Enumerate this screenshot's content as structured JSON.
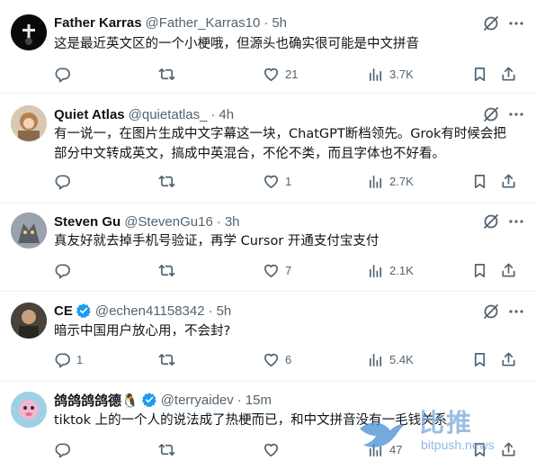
{
  "tweets": [
    {
      "name": "Father Karras",
      "handle": "@Father_Karras10",
      "dot": "·",
      "time": "5h",
      "verified": false,
      "lines": [
        "这是最近英文区的一个小梗哦，但源头也确实很可能是中文拼音"
      ],
      "replies": "",
      "retweets": "",
      "likes": "21",
      "views": "3.7K"
    },
    {
      "name": "Quiet Atlas",
      "handle": "@quietatlas_",
      "dot": "·",
      "time": "4h",
      "verified": false,
      "lines": [
        "有一说一，在图片生成中文字幕这一块，ChatGPT断档领先。Grok有时候会把",
        "部分中文转成英文，搞成中英混合，不伦不类，而且字体也不好看。"
      ],
      "replies": "",
      "retweets": "",
      "likes": "1",
      "views": "2.7K"
    },
    {
      "name": "Steven Gu",
      "handle": "@StevenGu16",
      "dot": "·",
      "time": "3h",
      "verified": false,
      "lines": [
        "真友好就去掉手机号验证，再学 Cursor 开通支付宝支付"
      ],
      "replies": "",
      "retweets": "",
      "likes": "7",
      "views": "2.1K"
    },
    {
      "name": "CE",
      "handle": "@echen41158342",
      "dot": "·",
      "time": "5h",
      "verified": true,
      "lines": [
        "暗示中国用户放心用，不会封?"
      ],
      "replies": "1",
      "retweets": "",
      "likes": "6",
      "views": "5.4K"
    },
    {
      "name": "鸽鸽鸽鸽德🐧",
      "handle": "@terryaidev",
      "dot": "·",
      "time": "15m",
      "verified": true,
      "lines": [
        "tiktok 上的一个人的说法成了热梗而已，和中文拼音没有一毛钱关系"
      ],
      "replies": "",
      "retweets": "",
      "likes": "",
      "views": "47"
    }
  ],
  "watermark": {
    "cn": "比推",
    "en": "bitpush.news"
  },
  "colors": {
    "text": "#0f1419",
    "secondary": "#536471",
    "verified": "#1d9bf0",
    "divider": "#eff3f4"
  },
  "icons": {
    "reply": "reply-icon",
    "retweet": "retweet-icon",
    "like": "heart-icon",
    "views": "views-chart-icon",
    "bookmark": "bookmark-icon",
    "share": "share-icon",
    "grok": "grok-icon",
    "more": "more-dots-icon"
  }
}
